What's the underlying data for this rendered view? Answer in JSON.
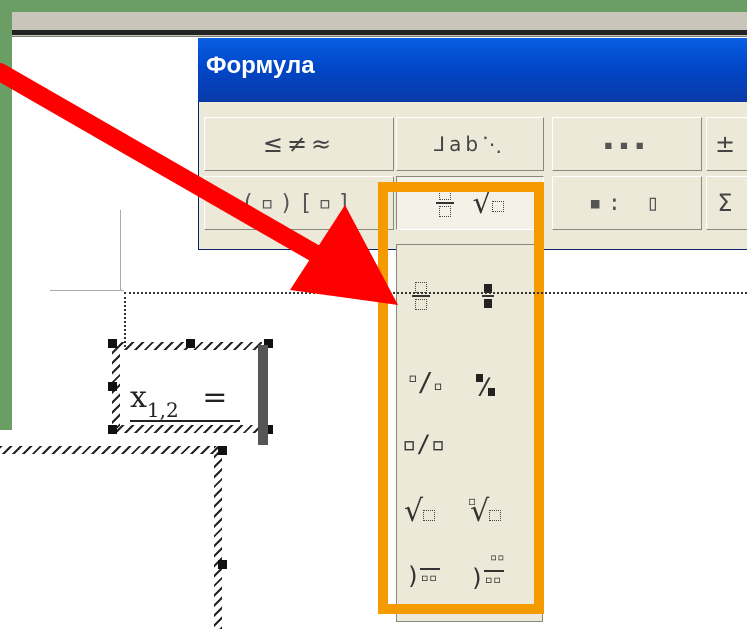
{
  "window": {
    "title": "Формула"
  },
  "toolbar": {
    "row1": [
      "≤≠≈",
      "⅃ab⋱",
      "▪▪▪",
      "±"
    ],
    "row2": [
      "(▫)[▫]",
      "fraction-radical",
      "▪: ▯",
      "Σ"
    ]
  },
  "dropdown": {
    "items": [
      "full-size-fraction",
      "small-fraction",
      "slash-fraction",
      "small-slash-fraction",
      "horizontal-slash-fraction",
      "square-root",
      "nth-root",
      "long-division",
      "long-division-with-quotient"
    ]
  },
  "equation": {
    "variable": "x",
    "subscript": "1,2",
    "operator": "="
  },
  "colors": {
    "highlight": "#f59b00",
    "arrow": "#ff0000",
    "titlebar": "#0a5fe3",
    "slide_background": "#6a9e64"
  }
}
